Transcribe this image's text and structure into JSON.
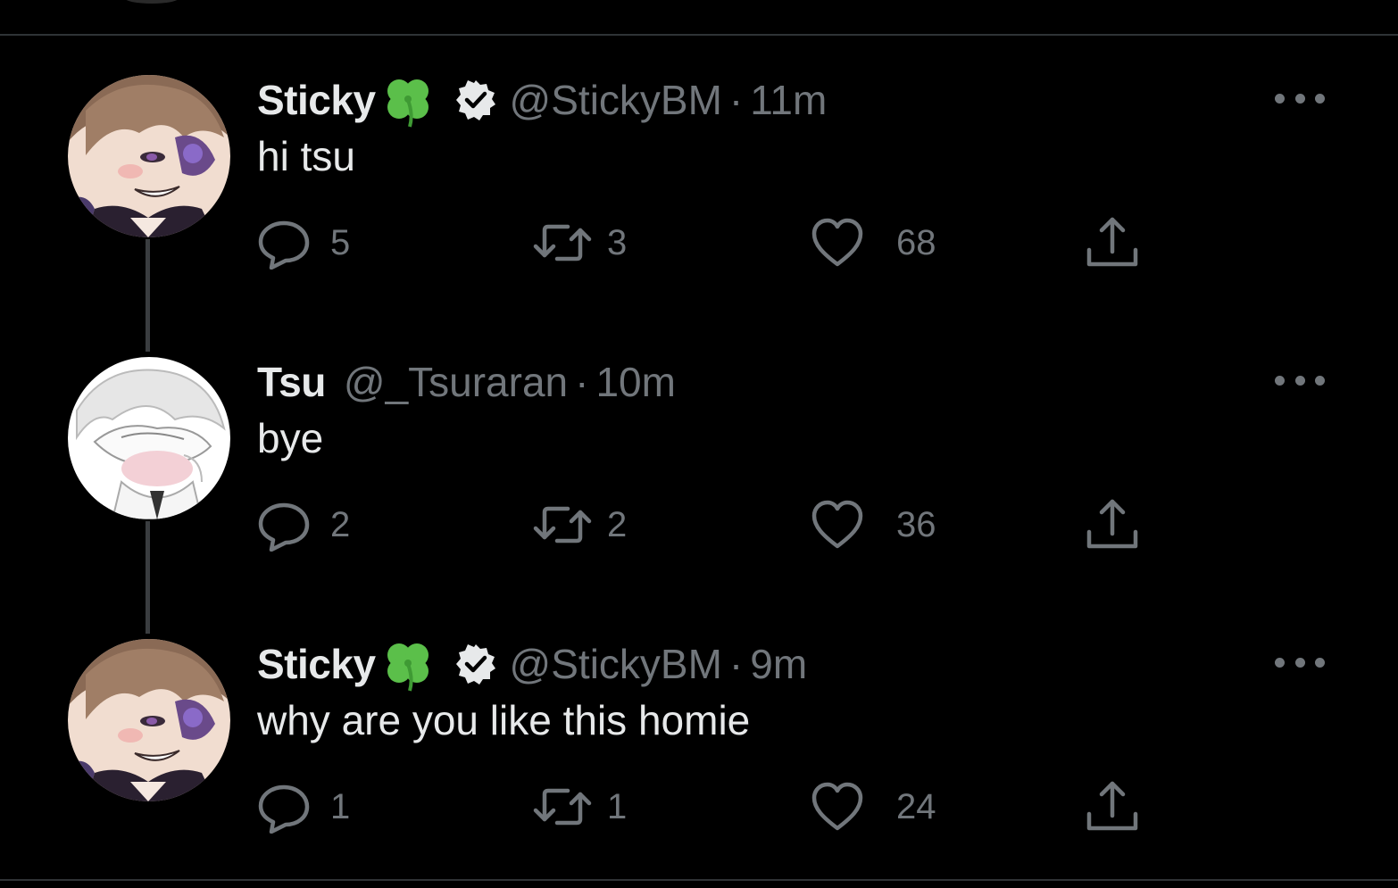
{
  "tweets": [
    {
      "name": "Sticky",
      "handle": "@StickyBM",
      "separator": "·",
      "time": "11m",
      "verified": true,
      "text": "hi tsu",
      "replies": "5",
      "retweets": "3",
      "likes": "68",
      "avatar": "sticky-avatar"
    },
    {
      "name": "Tsu",
      "handle": "@_Tsuraran",
      "separator": "·",
      "time": "10m",
      "verified": false,
      "text": "bye",
      "replies": "2",
      "retweets": "2",
      "likes": "36",
      "avatar": "tsu-avatar"
    },
    {
      "name": "Sticky",
      "handle": "@StickyBM",
      "separator": "·",
      "time": "9m",
      "verified": true,
      "text": "why are you like this homie",
      "replies": "1",
      "retweets": "1",
      "likes": "24",
      "avatar": "sticky-avatar"
    }
  ],
  "icons": {
    "clover": "four-leaf-clover-icon",
    "verified": "verified-badge-icon",
    "reply": "reply-icon",
    "retweet": "retweet-icon",
    "like": "heart-icon",
    "share": "share-icon",
    "more": "more-options-icon"
  },
  "colors": {
    "background": "#000000",
    "primary_text": "#e7e9ea",
    "secondary_text": "#71767b",
    "divider": "#2f3336",
    "clover": "#5bbf4a"
  }
}
